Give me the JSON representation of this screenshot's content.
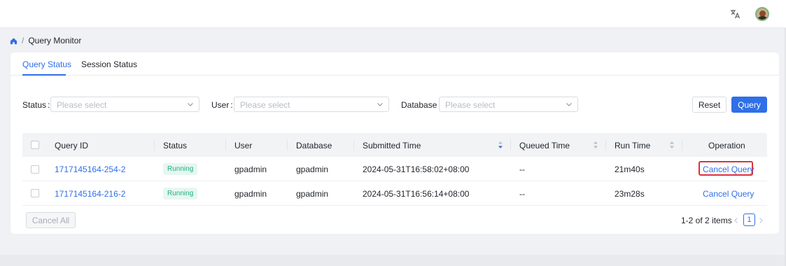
{
  "header": {
    "language_icon": "translate-icon",
    "avatar_icon": "user-avatar"
  },
  "breadcrumb": {
    "home_icon": "home-icon",
    "separator": "/",
    "current": "Query Monitor"
  },
  "tabs": [
    {
      "label": "Query Status",
      "active": true
    },
    {
      "label": "Session Status",
      "active": false
    }
  ],
  "filters": {
    "status": {
      "label": "Status",
      "colon": ":",
      "placeholder": "Please select"
    },
    "user": {
      "label": "User",
      "colon": ":",
      "placeholder": "Please select"
    },
    "database": {
      "label": "Database",
      "colon": ":",
      "placeholder": "Please select"
    },
    "reset_label": "Reset",
    "query_label": "Query"
  },
  "table": {
    "columns": [
      "Query ID",
      "Status",
      "User",
      "Database",
      "Submitted Time",
      "Queued Time",
      "Run Time",
      "Operation"
    ],
    "rows": [
      {
        "query_id": "1717145164-254-2",
        "status": "Running",
        "user": "gpadmin",
        "database": "gpadmin",
        "submitted_time": "2024-05-31T16:58:02+08:00",
        "queued_time": "--",
        "run_time": "21m40s",
        "operation": "Cancel Query",
        "highlighted": true
      },
      {
        "query_id": "1717145164-216-2",
        "status": "Running",
        "user": "gpadmin",
        "database": "gpadmin",
        "submitted_time": "2024-05-31T16:56:14+08:00",
        "queued_time": "--",
        "run_time": "23m28s",
        "operation": "Cancel Query",
        "highlighted": false
      }
    ]
  },
  "footer": {
    "cancel_all_label": "Cancel All",
    "pagination_summary": "1-2 of 2 items",
    "current_page": "1"
  },
  "colors": {
    "accent": "#2f6fe8",
    "running_tag_bg": "#e7f7f0",
    "running_tag_text": "#1fae83",
    "highlight_border": "#e0303a"
  }
}
